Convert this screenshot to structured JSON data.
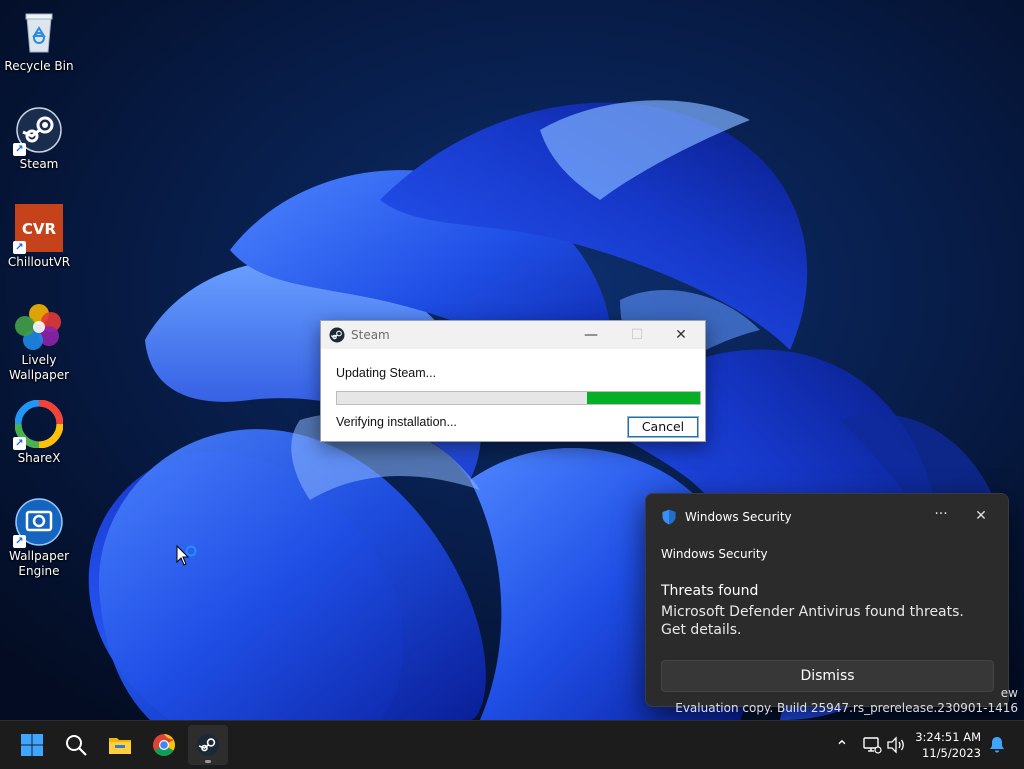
{
  "desktop": {
    "icons": [
      {
        "label": "Recycle Bin"
      },
      {
        "label": "Steam"
      },
      {
        "label": "ChilloutVR",
        "badge": "CVR"
      },
      {
        "label": "Lively Wallpaper"
      },
      {
        "label": "ShareX"
      },
      {
        "label": "Wallpaper Engine"
      }
    ]
  },
  "steam_window": {
    "title": "Steam",
    "status": "Updating Steam...",
    "progress_fraction": 0.31,
    "detail": "Verifying installation...",
    "cancel_label": "Cancel",
    "minimize_glyph": "—",
    "maximize_glyph": "☐",
    "close_glyph": "✕"
  },
  "toast": {
    "app_name": "Windows Security",
    "subtitle": "Windows Security",
    "title": "Threats found",
    "message": "Microsoft Defender Antivirus found threats. Get details.",
    "dismiss_label": "Dismiss",
    "more_glyph": "···",
    "close_glyph": "✕"
  },
  "watermark": {
    "line1": "ew",
    "line2": "Evaluation copy. Build 25947.rs_prerelease.230901-1416"
  },
  "taskbar": {
    "apps": [
      "start-icon",
      "search-icon",
      "file-explorer-icon",
      "chrome-icon",
      "steam-icon"
    ],
    "tray": [
      "chevron-up-icon",
      "network-icon",
      "volume-icon",
      "bell-icon"
    ],
    "time": "3:24:51 AM",
    "date": "11/5/2023",
    "chevron_glyph": "⌃"
  },
  "colors": {
    "accent": "#0078d4",
    "progress": "#06b025",
    "taskbar": "#1c1c1c",
    "toast_bg": "#2b2b2b"
  }
}
